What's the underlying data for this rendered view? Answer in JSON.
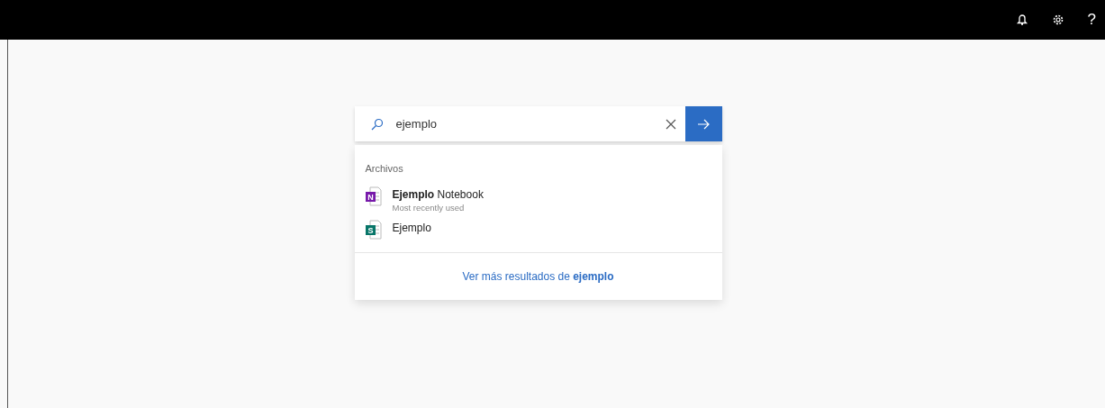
{
  "top_bar": {
    "help": "?"
  },
  "search": {
    "value": "ejemplo"
  },
  "results": {
    "section": "Archivos",
    "files": [
      {
        "kind": "onenote",
        "badge": "N",
        "title": "**Ejemplo** Notebook",
        "subtitle": "Most recently used"
      },
      {
        "kind": "sharepoint",
        "badge": "S",
        "title": "Ejemplo"
      }
    ],
    "more_link": "Ver más resultados de **ejemplo**"
  }
}
